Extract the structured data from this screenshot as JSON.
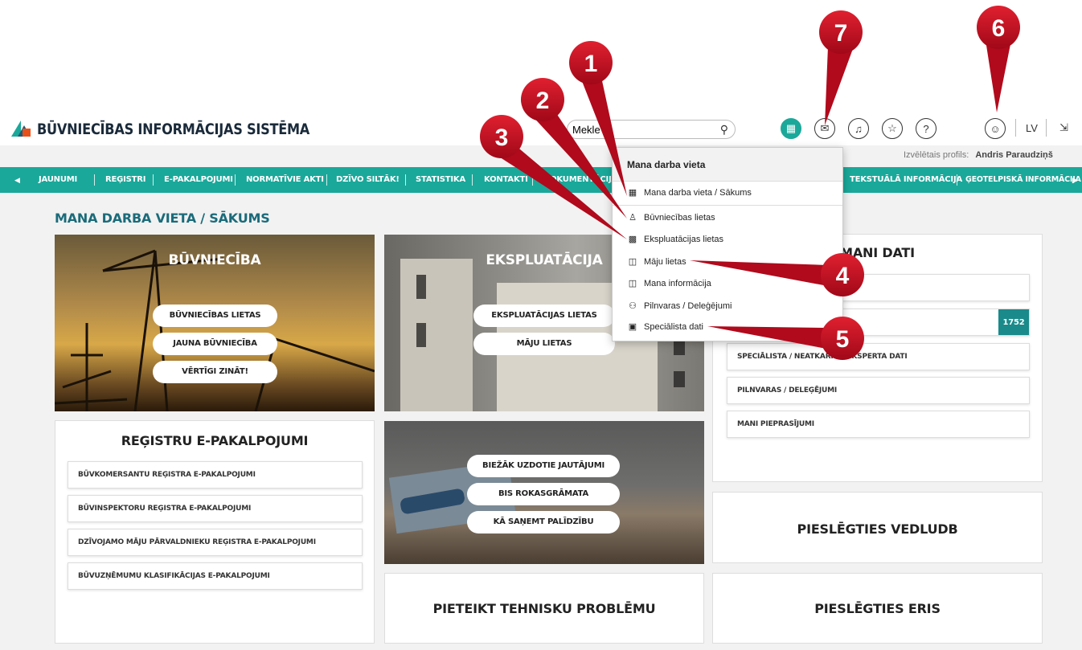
{
  "header": {
    "logo_text": "BŪVNIECĪBAS INFORMĀCIJAS SISTĒMA",
    "search_value": "Mekle",
    "lang": "LV",
    "profile_label": "Izvēlētais profils:",
    "profile_name": "Andris Paraudziņš"
  },
  "nav": {
    "items": [
      "JAUNUMI",
      "REĢISTRI",
      "E-PAKALPOJUMI",
      "NORMATĪVIE AKTI",
      "DZĪVO SILTĀK!",
      "STATISTIKA",
      "KONTAKTI",
      "DOKUMENTĀCIJA",
      "TEKSTUĀLĀ INFORMĀCIJA",
      "ĢEOTELPISKĀ INFORMĀCIJA"
    ]
  },
  "page_title": "MANA DARBA VIETA / SĀKUMS",
  "buvnieciba": {
    "title": "BŪVNIECĪBA",
    "buttons": [
      "BŪVNIECĪBAS LIETAS",
      "JAUNA BŪVNIECĪBA",
      "VĒRTĪGI ZINĀT!"
    ]
  },
  "ekspluatacija": {
    "title": "EKSPLUATĀCIJA",
    "buttons": [
      "EKSPLUATĀCIJAS LIETAS",
      "MĀJU LIETAS"
    ]
  },
  "registri": {
    "title": "REĢISTRU E-PAKALPOJUMI",
    "items": [
      "BŪVKOMERSANTU REĢISTRA E-PAKALPOJUMI",
      "BŪVINSPEKTORU REĢISTRA E-PAKALPOJUMI",
      "DZĪVOJAMO MĀJU PĀRVALDNIEKU REĢISTRA E-PAKALPOJUMI",
      "BŪVUZŅĒMUMU KLASIFIKĀCIJAS E-PAKALPOJUMI"
    ]
  },
  "help": {
    "buttons": [
      "BIEŽĀK UZDOTIE JAUTĀJUMI",
      "BIS ROKASGRĀMATA",
      "KĀ SAŅEMT PALĪDZĪBU"
    ]
  },
  "mani_dati": {
    "title": "MANI DATI",
    "badge": "1752",
    "items": [
      "SPECIĀLISTA / NEATKARĪGĀ EKSPERTA DATI",
      "PILNVARAS / DELEĢĒJUMI",
      "MANI PIEPRASĪJUMI"
    ]
  },
  "tehniska_problema": "PIETEIKT TEHNISKU PROBLĒMU",
  "vedludb": "PIESLĒGTIES VEDLUDB",
  "eris": "PIESLĒGTIES ERIS",
  "dropdown": {
    "title": "Mana darba vieta",
    "items": [
      {
        "label": "Mana darba vieta / Sākums",
        "icon": "grid-icon"
      },
      {
        "label": "Būvniecības lietas",
        "icon": "worker-icon"
      },
      {
        "label": "Ekspluatācijas lietas",
        "icon": "building-icon"
      },
      {
        "label": "Māju lietas",
        "icon": "house-icon"
      },
      {
        "label": "Mana informācija",
        "icon": "folder-icon"
      },
      {
        "label": "Pilnvaras / Deleģējumi",
        "icon": "people-icon"
      },
      {
        "label": "Speciālista dati",
        "icon": "briefcase-icon"
      }
    ]
  },
  "annotations": [
    "1",
    "2",
    "3",
    "4",
    "5",
    "6",
    "7"
  ],
  "colors": {
    "teal": "#1aa89a",
    "pin_red": "#c8102e"
  }
}
